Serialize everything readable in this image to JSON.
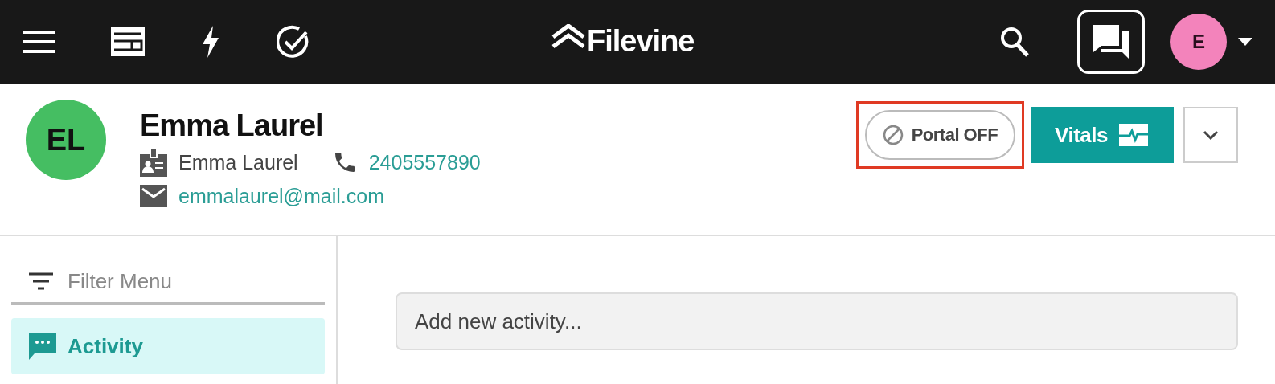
{
  "topbar": {
    "logo": "Filevine",
    "avatar": "E"
  },
  "contact": {
    "initials": "EL",
    "name": "Emma Laurel",
    "card_name": "Emma Laurel",
    "phone": "2405557890",
    "email": "emmalaurel@mail.com"
  },
  "actions": {
    "portal": {
      "label": "Portal OFF",
      "highlighted": true
    },
    "vitals": {
      "label": "Vitals"
    }
  },
  "sidebar": {
    "filter": {
      "placeholder": "Filter Menu"
    },
    "items": [
      {
        "label": "Activity",
        "selected": true
      }
    ]
  },
  "feed": {
    "new_activity": {
      "placeholder": "Add new activity..."
    }
  }
}
